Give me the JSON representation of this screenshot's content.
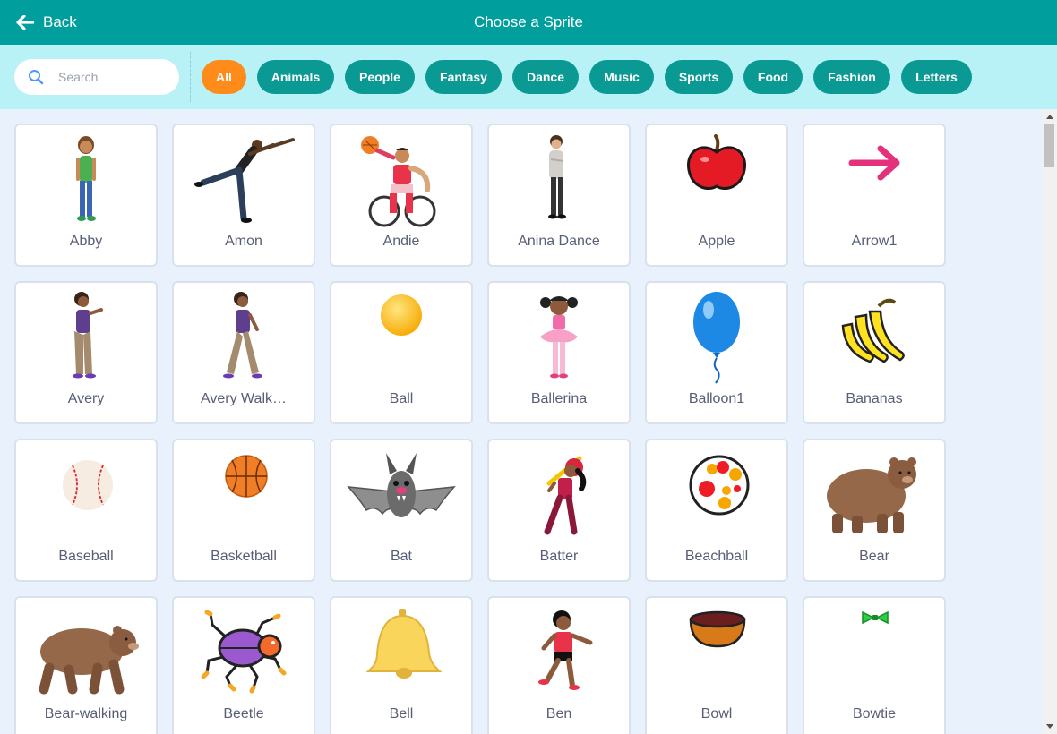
{
  "header": {
    "back_label": "Back",
    "title": "Choose a Sprite"
  },
  "search": {
    "placeholder": "Search",
    "value": ""
  },
  "filters": [
    "All",
    "Animals",
    "People",
    "Fantasy",
    "Dance",
    "Music",
    "Sports",
    "Food",
    "Fashion",
    "Letters"
  ],
  "active_filter": "All",
  "colors": {
    "header": "#009e9c",
    "filter_bar": "#b8f1f6",
    "pill": "#0b9a93",
    "pill_active": "#ff8c1a",
    "background": "#e9f1fc"
  },
  "sprites": [
    {
      "name": "Abby",
      "icon": "abby-icon"
    },
    {
      "name": "Amon",
      "icon": "amon-icon"
    },
    {
      "name": "Andie",
      "icon": "andie-icon"
    },
    {
      "name": "Anina Dance",
      "icon": "anina-dance-icon"
    },
    {
      "name": "Apple",
      "icon": "apple-icon"
    },
    {
      "name": "Arrow1",
      "icon": "arrow-icon"
    },
    {
      "name": "Avery",
      "icon": "avery-icon"
    },
    {
      "name": "Avery Walk…",
      "icon": "avery-walking-icon"
    },
    {
      "name": "Ball",
      "icon": "ball-icon"
    },
    {
      "name": "Ballerina",
      "icon": "ballerina-icon"
    },
    {
      "name": "Balloon1",
      "icon": "balloon-icon"
    },
    {
      "name": "Bananas",
      "icon": "bananas-icon"
    },
    {
      "name": "Baseball",
      "icon": "baseball-icon"
    },
    {
      "name": "Basketball",
      "icon": "basketball-icon"
    },
    {
      "name": "Bat",
      "icon": "bat-icon"
    },
    {
      "name": "Batter",
      "icon": "batter-icon"
    },
    {
      "name": "Beachball",
      "icon": "beachball-icon"
    },
    {
      "name": "Bear",
      "icon": "bear-icon"
    },
    {
      "name": "Bear-walking",
      "icon": "bear-walking-icon"
    },
    {
      "name": "Beetle",
      "icon": "beetle-icon"
    },
    {
      "name": "Bell",
      "icon": "bell-icon"
    },
    {
      "name": "Ben",
      "icon": "ben-icon"
    },
    {
      "name": "Bowl",
      "icon": "bowl-icon"
    },
    {
      "name": "Bowtie",
      "icon": "bowtie-icon"
    }
  ]
}
